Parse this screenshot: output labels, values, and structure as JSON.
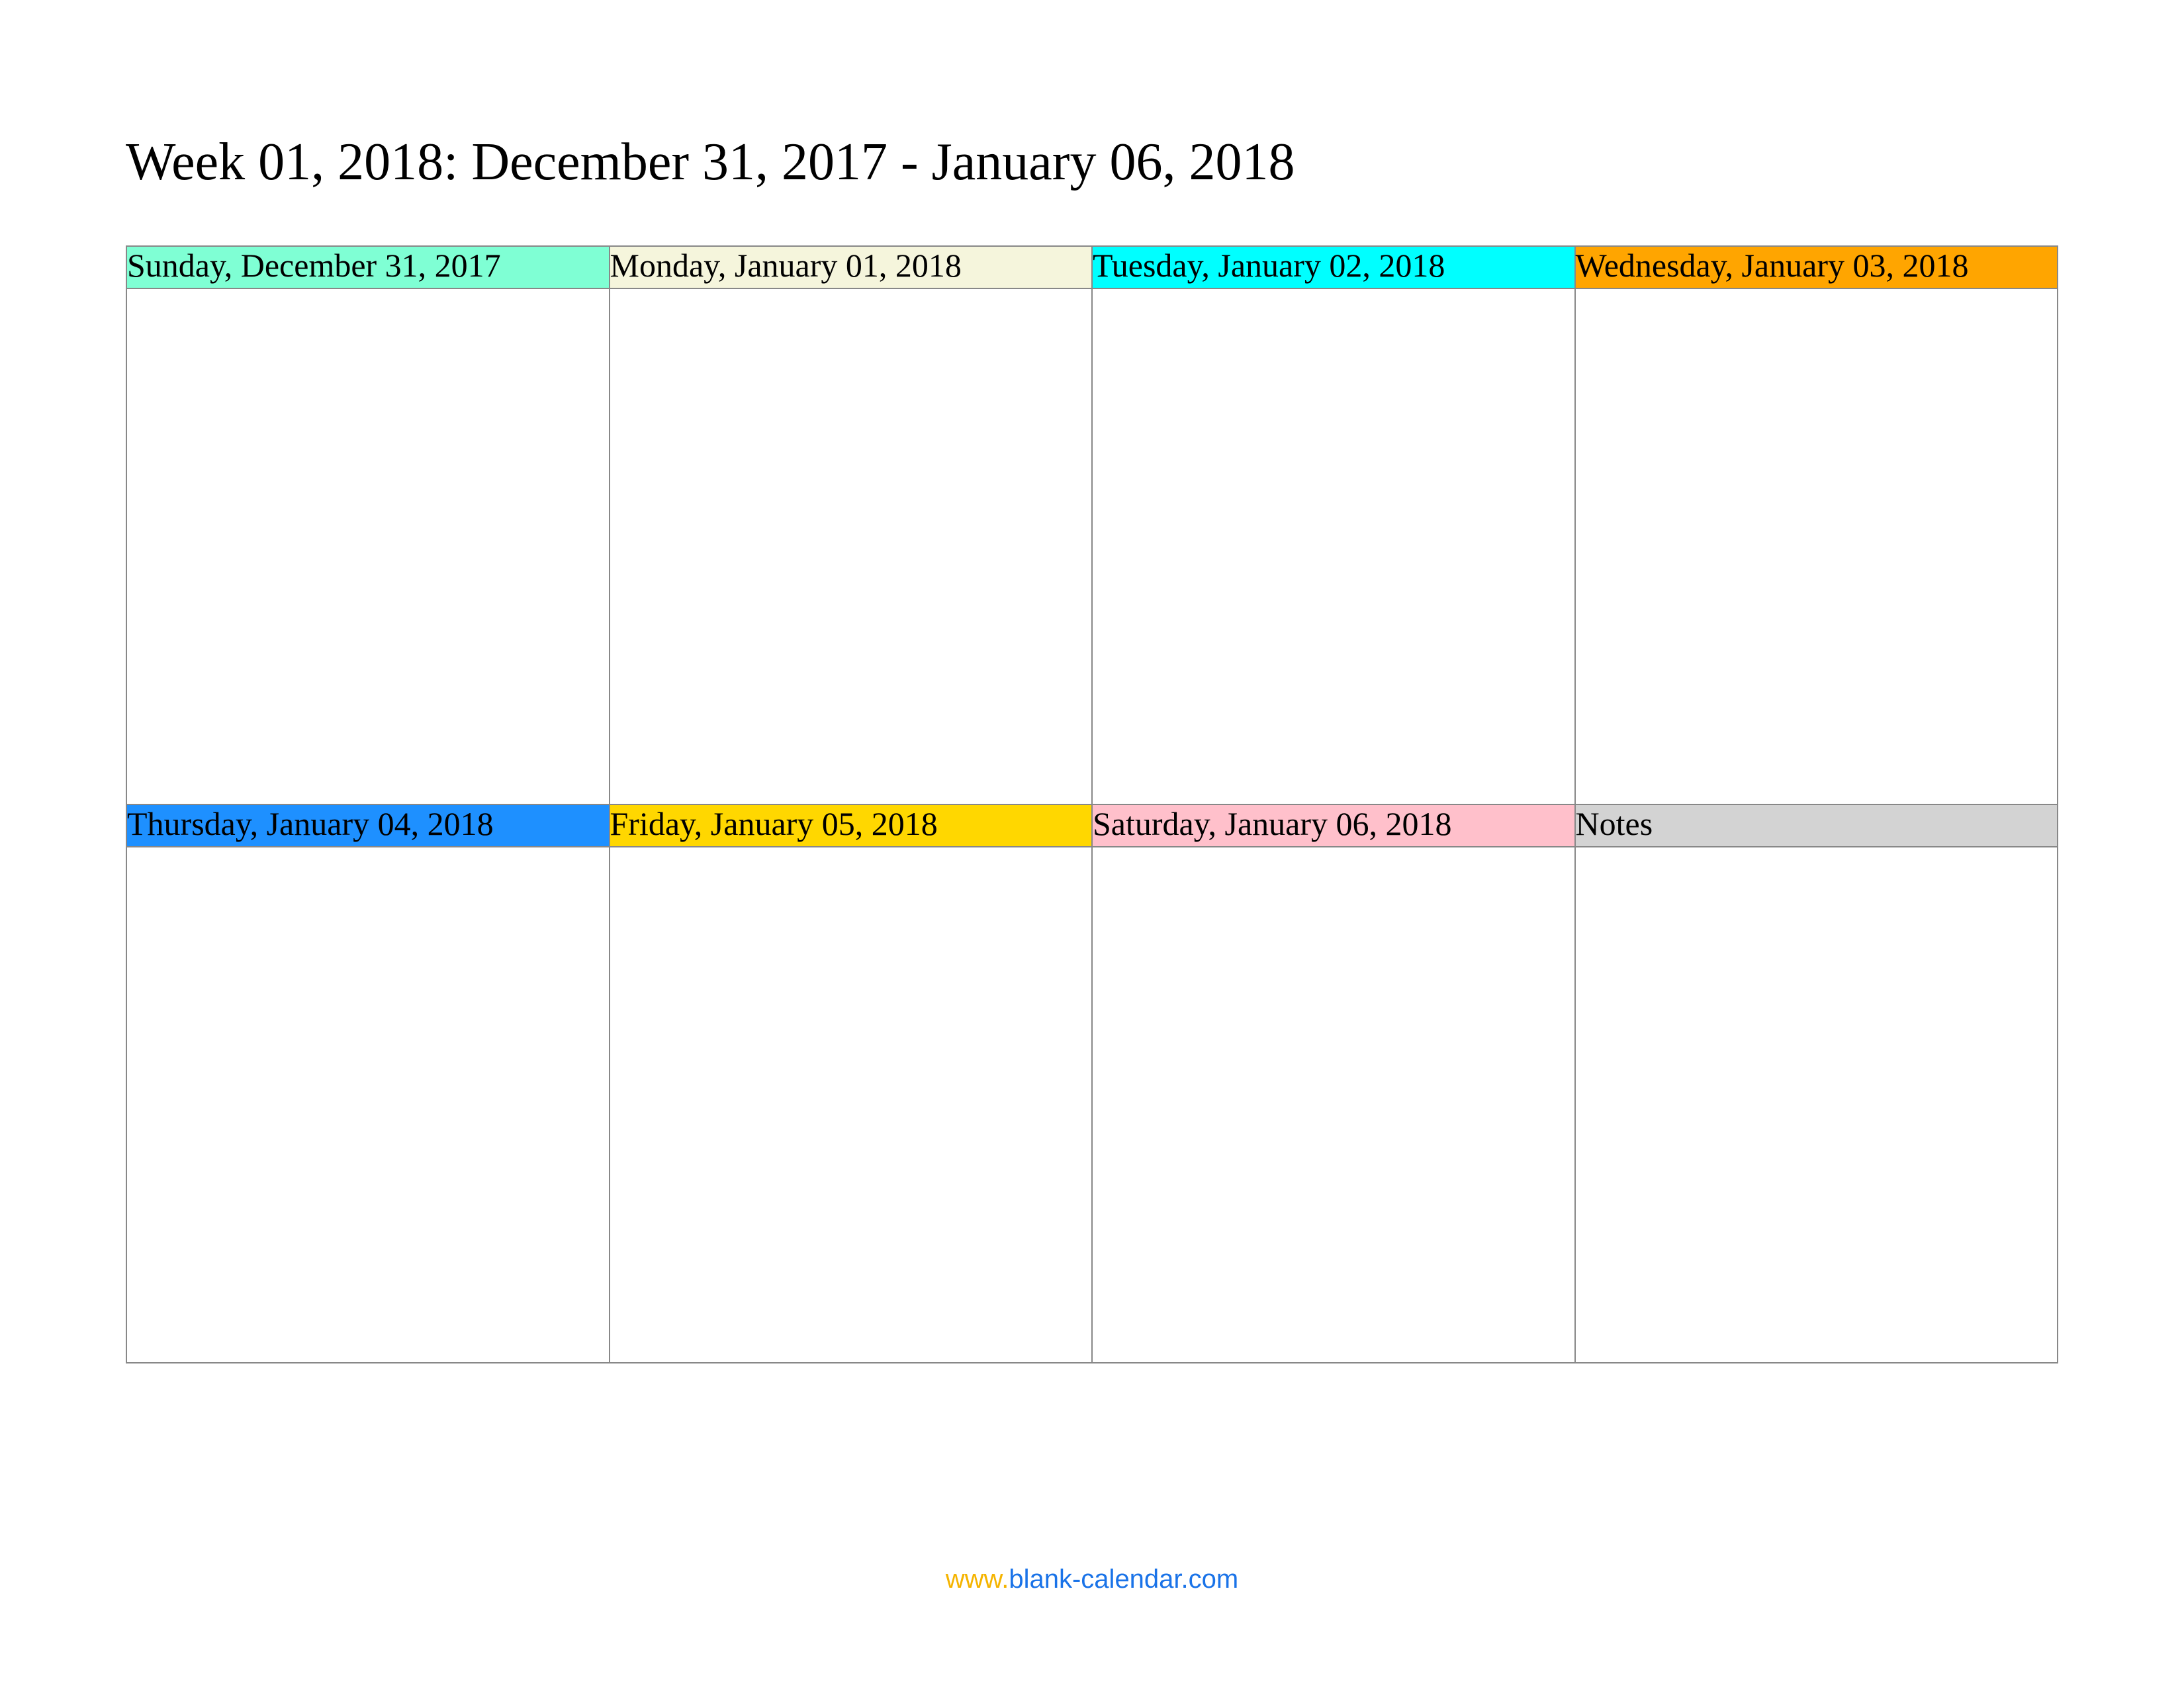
{
  "title": "Week 01, 2018: December 31, 2017 - January 06, 2018",
  "cells": [
    {
      "label": "Sunday, December 31, 2017",
      "bg": "#7fffd4"
    },
    {
      "label": "Monday, January 01, 2018",
      "bg": "#f5f5dc"
    },
    {
      "label": "Tuesday, January 02, 2018",
      "bg": "#00ffff"
    },
    {
      "label": "Wednesday, January 03, 2018",
      "bg": "#ffa500"
    },
    {
      "label": "Thursday, January 04, 2018",
      "bg": "#1e90ff"
    },
    {
      "label": "Friday, January 05, 2018",
      "bg": "#ffd700"
    },
    {
      "label": "Saturday, January 06, 2018",
      "bg": "#ffc0cb"
    },
    {
      "label": "Notes",
      "bg": "#d3d3d3"
    }
  ],
  "footer": {
    "www": "www.",
    "domain": "blank-calendar.com"
  }
}
